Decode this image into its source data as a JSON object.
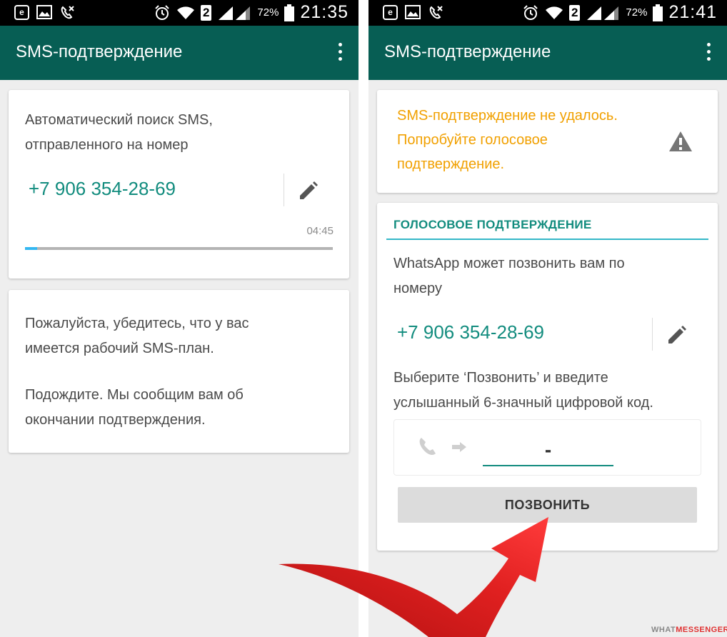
{
  "colors": {
    "app_bar": "#075e54",
    "accent": "#128c7e",
    "progress_fill": "#34b7f1",
    "warning": "#f1a000",
    "arrow": "#e02020"
  },
  "screens": [
    {
      "status_bar": {
        "battery": "72%",
        "time": "21:35",
        "sim_badge": "2",
        "icons": [
          "e-badge-icon",
          "image-icon",
          "missed-call-icon",
          "alarm-icon",
          "wifi-icon",
          "signal-icon",
          "battery-icon"
        ]
      },
      "app_bar": {
        "title": "SMS-подтверждение",
        "menu_icon": "overflow-menu-icon"
      },
      "sms_card": {
        "text_line1": "Автоматический поиск SMS,",
        "text_line2": "отправленного на номер",
        "phone": "+7 906 354-28-69",
        "edit_icon": "pencil-icon",
        "timer": "04:45",
        "progress": 0.04
      },
      "info_card": {
        "line1": "Пожалуйста, убедитесь, что у вас",
        "line2": "имеется рабочий SMS-план.",
        "line3": "Подождите. Мы сообщим вам об",
        "line4": "окончании подтверждения."
      }
    },
    {
      "status_bar": {
        "battery": "72%",
        "time": "21:41",
        "sim_badge": "2",
        "icons": [
          "e-badge-icon",
          "image-icon",
          "missed-call-icon",
          "alarm-icon",
          "wifi-icon",
          "signal-icon",
          "battery-icon"
        ]
      },
      "app_bar": {
        "title": "SMS-подтверждение",
        "menu_icon": "overflow-menu-icon"
      },
      "warning_card": {
        "line1": "SMS-подтверждение не удалось.",
        "line2": "Попробуйте голосовое",
        "line3": "подтверждение.",
        "icon": "warning-icon"
      },
      "voice_card": {
        "title": "ГОЛОСОВОЕ ПОДТВЕРЖДЕНИЕ",
        "text_line1": "WhatsApp может позвонить вам по",
        "text_line2": "номеру",
        "phone": "+7 906 354-28-69",
        "edit_icon": "pencil-icon",
        "instruction_line1": "Выберите ‘Позвонить’ и введите",
        "instruction_line2": "услышанный 6-значный цифровой код.",
        "code_value": "-",
        "call_button": "ПОЗВОНИТЬ"
      }
    }
  ],
  "watermark": {
    "part1": "WHAT",
    "part2": "MESSENGER"
  }
}
